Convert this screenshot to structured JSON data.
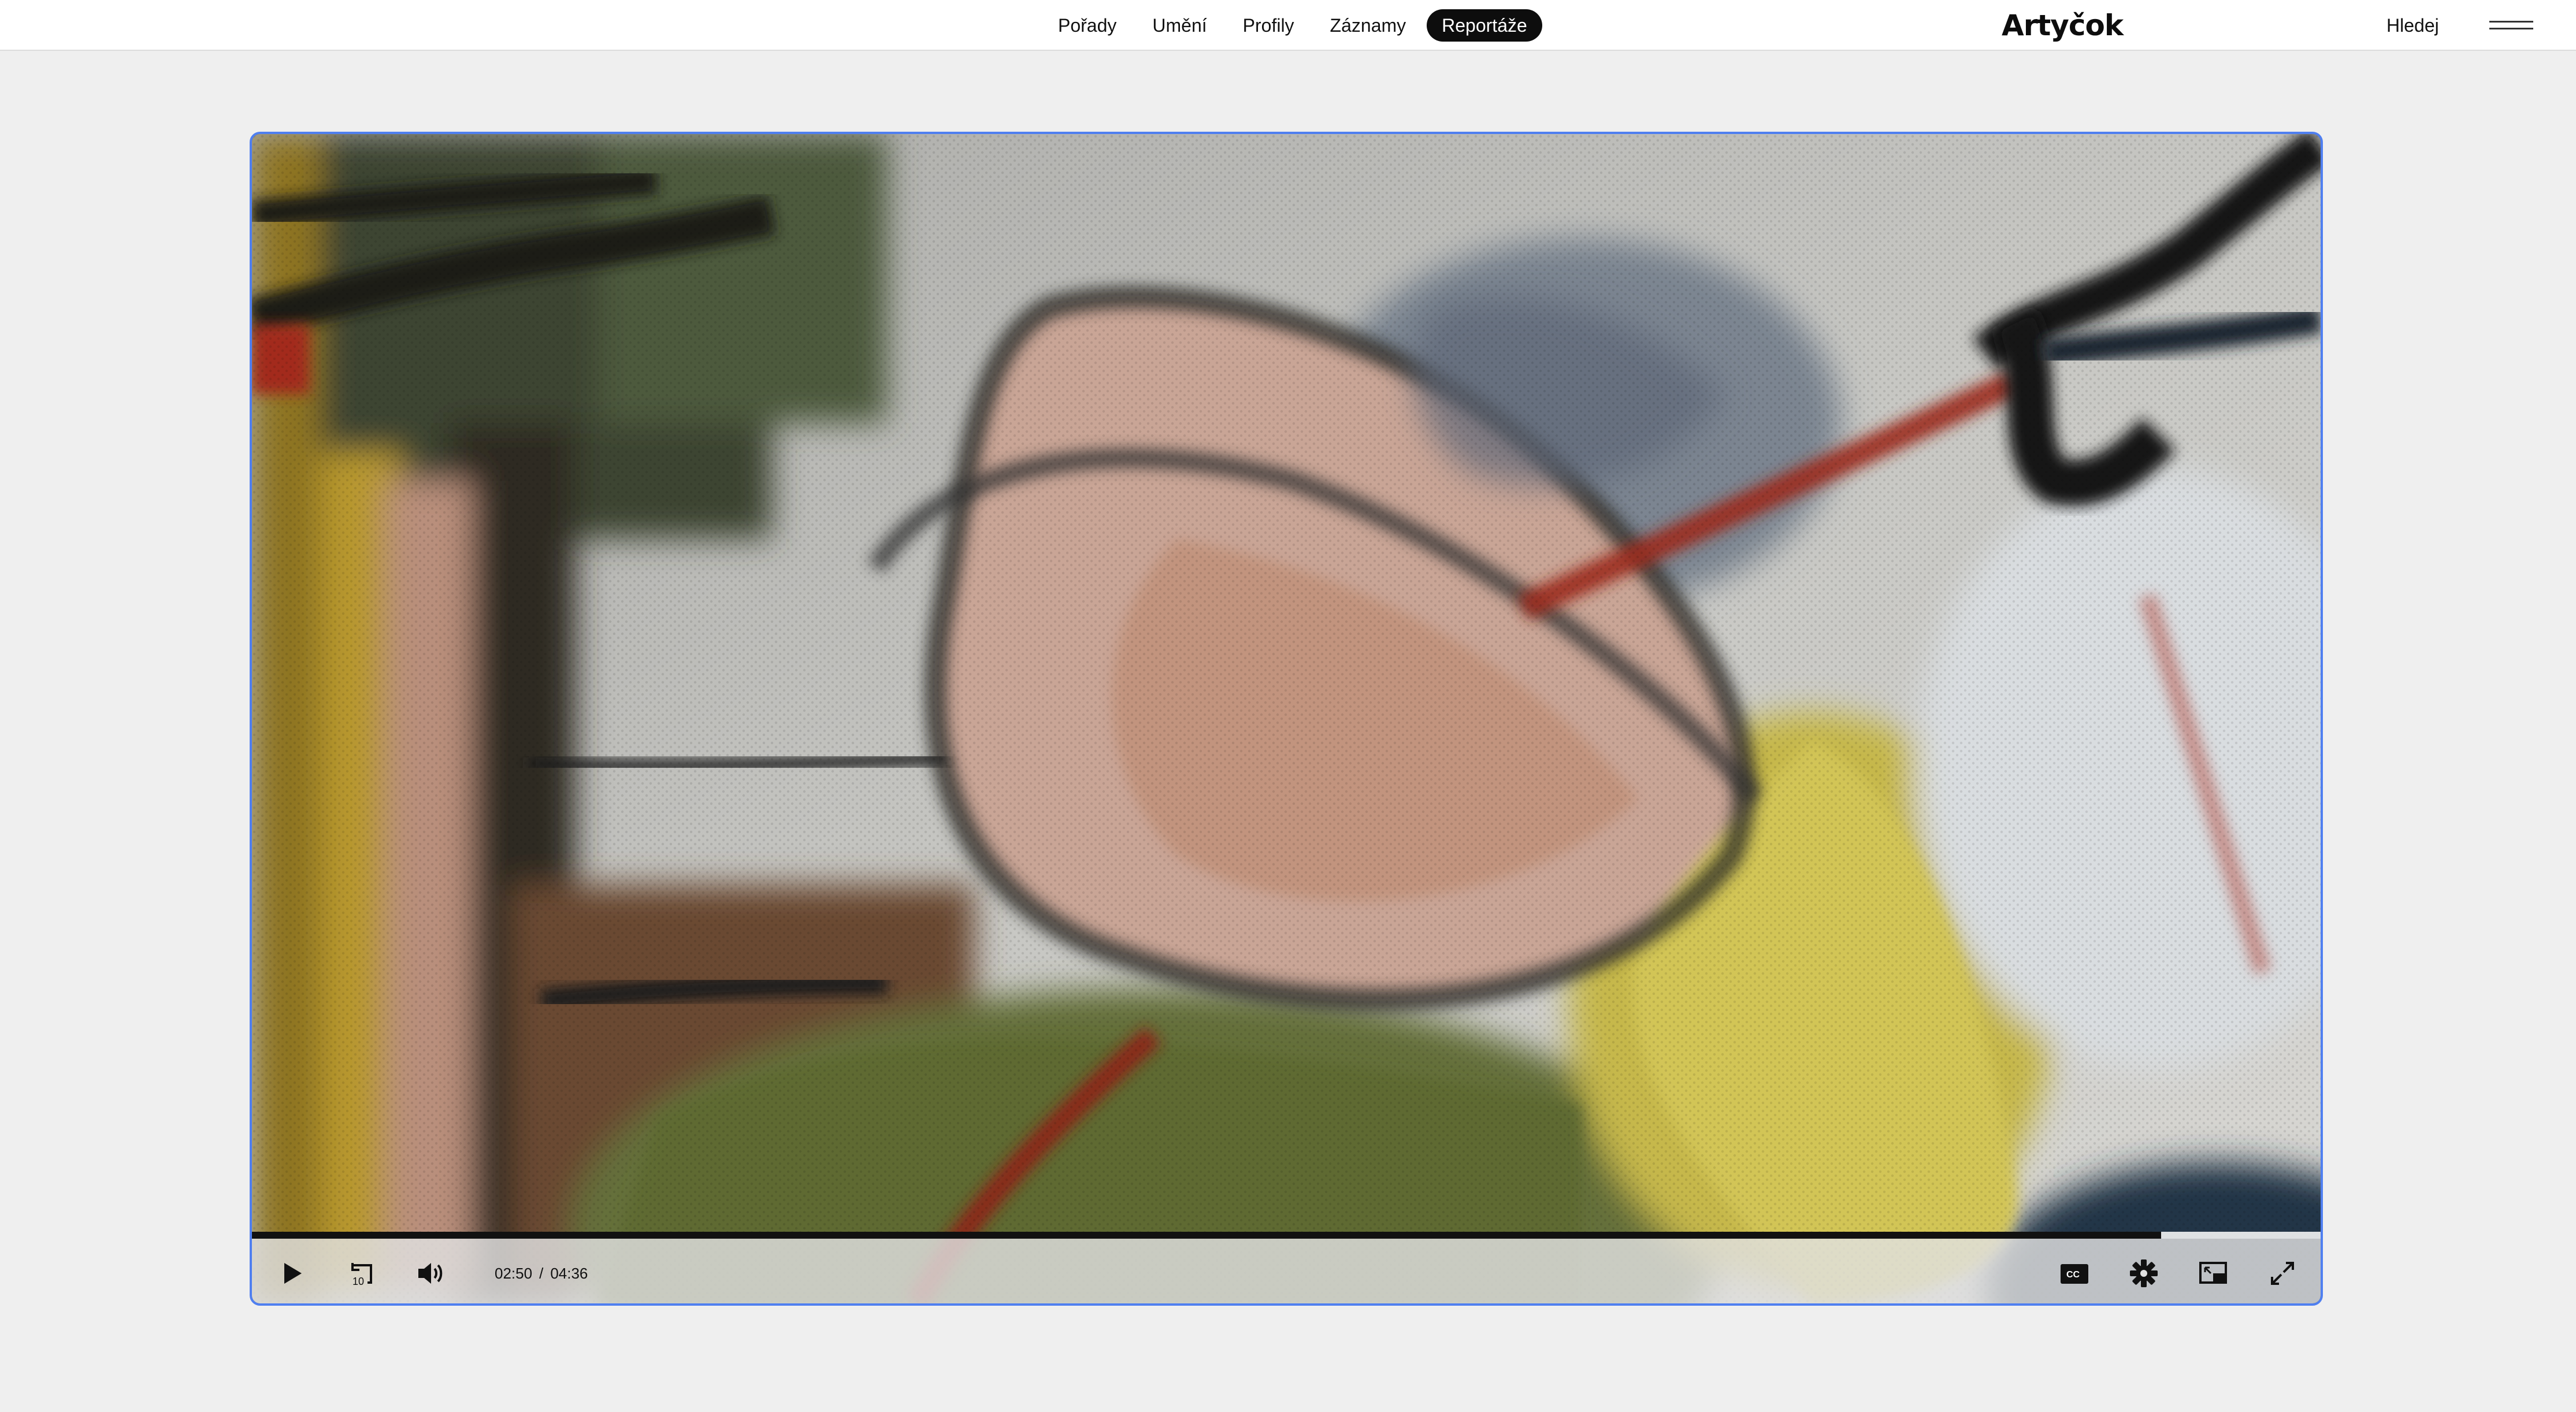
{
  "header": {
    "nav_items": [
      {
        "label": "Pořady",
        "active": false
      },
      {
        "label": "Umění",
        "active": false
      },
      {
        "label": "Profily",
        "active": false
      },
      {
        "label": "Záznamy",
        "active": false
      },
      {
        "label": "Reportáže",
        "active": true
      }
    ],
    "logo": "Artyčok",
    "search_label": "Hledej",
    "menu_icon": "hamburger-icon"
  },
  "player": {
    "current_time": "02:50",
    "separator": "/",
    "duration": "04:36",
    "progress_fraction": 0.923,
    "rewind_seconds": "10",
    "icons": {
      "play": "play-icon",
      "rewind": "rewind-10-icon",
      "volume": "volume-icon",
      "captions": "cc-icon",
      "settings": "gear-icon",
      "pip": "picture-in-picture-icon",
      "fullscreen": "fullscreen-icon"
    }
  },
  "colors": {
    "accent_border": "#4f7ff0",
    "active_nav_bg": "#0d0d0d",
    "page_bg": "#efefef"
  }
}
